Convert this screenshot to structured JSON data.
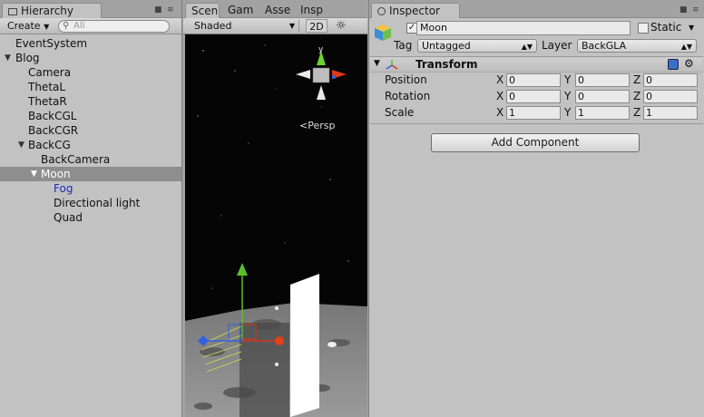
{
  "hierarchy": {
    "tab": "Hierarchy",
    "create_label": "Create",
    "search_placeholder": "All",
    "items": [
      {
        "label": "EventSystem"
      },
      {
        "label": "Blog"
      },
      {
        "label": "Camera"
      },
      {
        "label": "ThetaL"
      },
      {
        "label": "ThetaR"
      },
      {
        "label": "BackCGL"
      },
      {
        "label": "BackCGR"
      },
      {
        "label": "BackCG"
      },
      {
        "label": "BackCamera"
      },
      {
        "label": "Moon"
      },
      {
        "label": "Fog"
      },
      {
        "label": "Directional light"
      },
      {
        "label": "Quad"
      }
    ]
  },
  "scene": {
    "tabs": [
      "Scen",
      "Gam",
      "Asse",
      "Insp"
    ],
    "shading_mode": "Shaded",
    "mode_2d_label": "2D",
    "gizmo_y_label": "y",
    "projection_label": "Persp"
  },
  "inspector": {
    "tab": "Inspector",
    "object_name": "Moon",
    "static_label": "Static",
    "tag_label": "Tag",
    "tag_value": "Untagged",
    "layer_label": "Layer",
    "layer_value": "BackGLA",
    "transform": {
      "title": "Transform",
      "rows": [
        {
          "label": "Position",
          "x": "0",
          "y": "0",
          "z": "0"
        },
        {
          "label": "Rotation",
          "x": "0",
          "y": "0",
          "z": "0"
        },
        {
          "label": "Scale",
          "x": "1",
          "y": "1",
          "z": "1"
        }
      ],
      "axis_x": "X",
      "axis_y": "Y",
      "axis_z": "Z"
    },
    "add_component_label": "Add Component"
  }
}
